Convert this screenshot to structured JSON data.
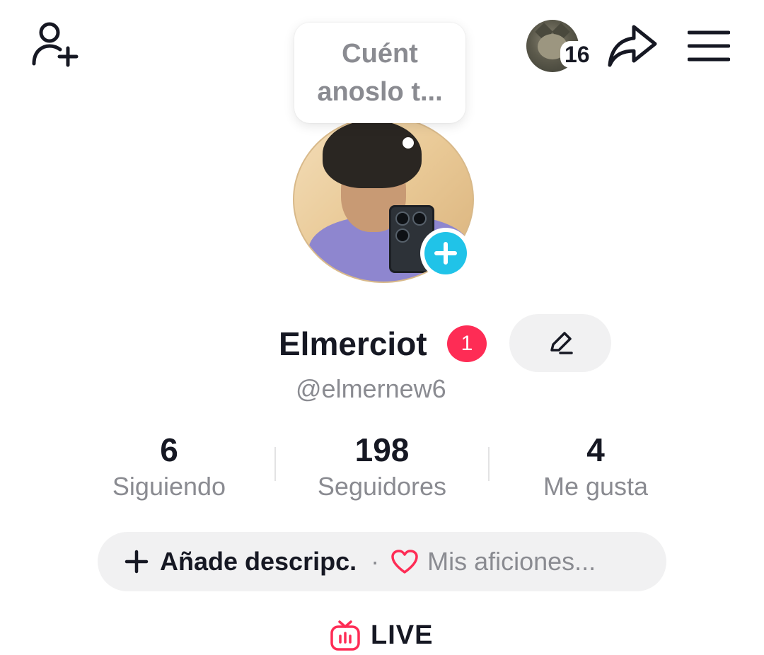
{
  "header": {
    "notification_count": "16",
    "icons": [
      "add-friend-icon",
      "share-icon",
      "menu-icon"
    ]
  },
  "bubble": {
    "text": "Cuént anoslo t..."
  },
  "profile": {
    "display_name": "Elmerciot",
    "name_badge": "1",
    "username": "@elmernew6"
  },
  "stats": [
    {
      "value": "6",
      "label": "Siguiendo"
    },
    {
      "value": "198",
      "label": "Seguidores"
    },
    {
      "value": "4",
      "label": "Me gusta"
    }
  ],
  "bio": {
    "add_label": "Añade descripc.",
    "separator": "·",
    "hobbies_label": "Mis aficiones..."
  },
  "live": {
    "label": "LIVE"
  },
  "colors": {
    "accent_red": "#fe2c55",
    "story_blue": "#20c3e8",
    "text_primary": "#161823",
    "text_secondary": "#8a8b91",
    "pill_bg": "#f1f1f2"
  }
}
